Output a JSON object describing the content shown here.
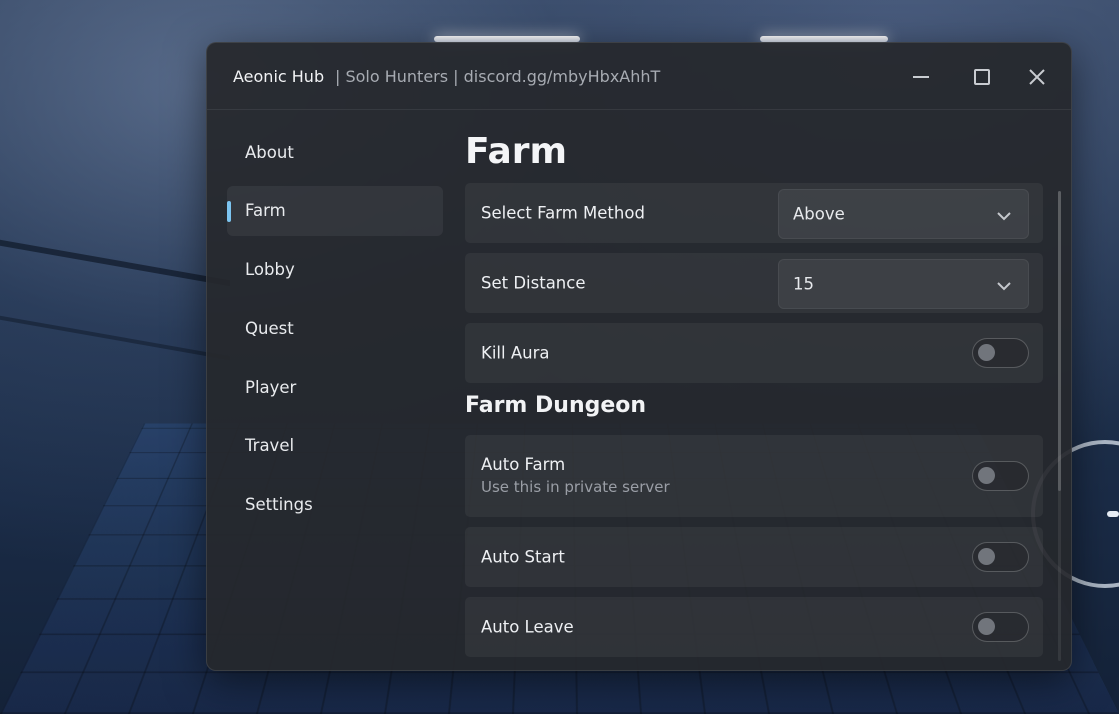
{
  "window": {
    "title": "Aeonic Hub",
    "subtitle": "| Solo Hunters | discord.gg/mbyHbxAhhT",
    "controls": [
      "minimize-icon",
      "maximize-icon",
      "close-icon"
    ]
  },
  "sidebar": {
    "items": [
      {
        "label": "About",
        "active": false
      },
      {
        "label": "Farm",
        "active": true
      },
      {
        "label": "Lobby",
        "active": false
      },
      {
        "label": "Quest",
        "active": false
      },
      {
        "label": "Player",
        "active": false
      },
      {
        "label": "Travel",
        "active": false
      },
      {
        "label": "Settings",
        "active": false
      }
    ]
  },
  "main": {
    "title": "Farm",
    "farm_method": {
      "label": "Select Farm Method",
      "value": "Above"
    },
    "distance": {
      "label": "Set Distance",
      "value": "15"
    },
    "kill_aura": {
      "label": "Kill Aura",
      "enabled": false
    },
    "dungeon_section": "Farm Dungeon",
    "auto_farm": {
      "label": "Auto Farm",
      "description": "Use this in private server",
      "enabled": false
    },
    "auto_start": {
      "label": "Auto Start",
      "enabled": false
    },
    "auto_leave": {
      "label": "Auto Leave",
      "enabled": false
    }
  },
  "colors": {
    "accent": "#7cc4f0",
    "window_bg": "#26282c",
    "text": "#eef0f3",
    "muted_text": "#9a9ea6"
  }
}
